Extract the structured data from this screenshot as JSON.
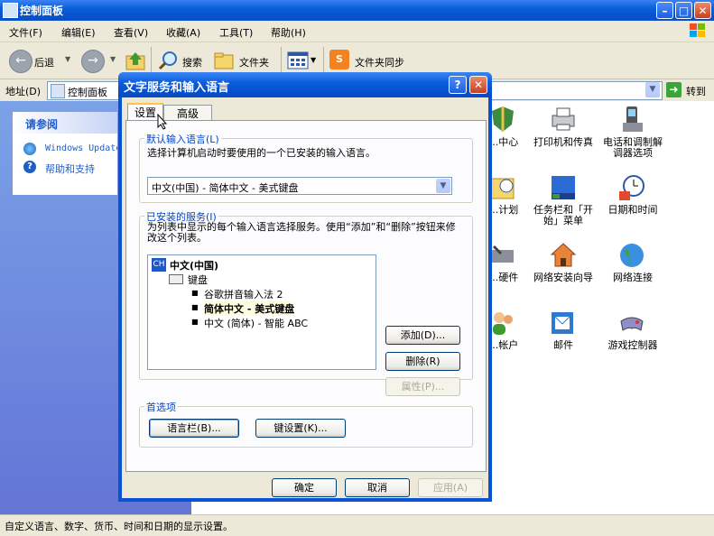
{
  "window": {
    "title": "控制面板"
  },
  "menu": [
    "文件(F)",
    "编辑(E)",
    "查看(V)",
    "收藏(A)",
    "工具(T)",
    "帮助(H)"
  ],
  "toolbar": {
    "back": "后退",
    "search": "搜索",
    "folders": "文件夹",
    "sync": "文件夹同步"
  },
  "address": {
    "label": "地址(D)",
    "value": "控制面板",
    "go": "转到"
  },
  "see_also": {
    "header": "请参阅",
    "links": [
      "Windows Update",
      "帮助和支持"
    ]
  },
  "icons": [
    {
      "label": "...中心",
      "icon": "shield-icon"
    },
    {
      "label": "打印机和传真",
      "icon": "printer-icon"
    },
    {
      "label": "电话和调制解调器选项",
      "icon": "phone-icon"
    },
    {
      "label": "...计划",
      "icon": "task-icon"
    },
    {
      "label": "任务栏和「开始」菜单",
      "icon": "taskbar-icon"
    },
    {
      "label": "日期和时间",
      "icon": "clock-icon"
    },
    {
      "label": "...硬件",
      "icon": "hardware-icon"
    },
    {
      "label": "网络安装向导",
      "icon": "home-network-icon"
    },
    {
      "label": "网络连接",
      "icon": "globe-icon"
    },
    {
      "label": "...帐户",
      "icon": "users-icon"
    },
    {
      "label": "邮件",
      "icon": "mail-icon"
    },
    {
      "label": "游戏控制器",
      "icon": "gamepad-icon"
    }
  ],
  "status": "自定义语言、数字、货币、时间和日期的显示设置。",
  "dialog": {
    "title": "文字服务和输入语言",
    "tabs": [
      "设置",
      "高级"
    ],
    "default_lang": {
      "label": "默认输入语言(L)",
      "desc": "选择计算机启动时要使用的一个已安装的输入语言。",
      "value": "中文(中国) - 简体中文 - 美式键盘"
    },
    "installed": {
      "label": "已安装的服务(I)",
      "desc": "为列表中显示的每个输入语言选择服务。使用“添加”和“删除”按钮来修改这个列表。",
      "lang_badge": "CH",
      "lang": "中文(中国)",
      "keyboard": "键盘",
      "services": [
        "谷歌拼音输入法 2",
        "简体中文 - 美式键盘",
        "中文 (简体) - 智能 ABC"
      ],
      "add": "添加(D)...",
      "remove": "删除(R)",
      "props": "属性(P)..."
    },
    "prefs": {
      "label": "首选项",
      "langbar": "语言栏(B)...",
      "keyset": "键设置(K)..."
    },
    "ok": "确定",
    "cancel": "取消",
    "apply": "应用(A)"
  }
}
